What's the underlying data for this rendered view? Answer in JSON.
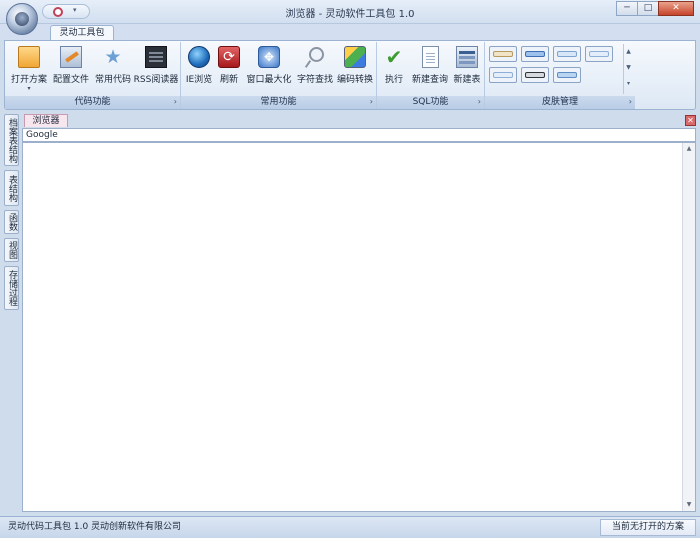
{
  "window": {
    "title": "浏览器 - 灵动软件工具包 1.0",
    "min_label": "─",
    "max_label": "□",
    "close_label": "✕"
  },
  "qat": {
    "more_glyph": "▾"
  },
  "ribbon": {
    "tab_label": "灵动工具包",
    "groups": [
      {
        "label": "代码功能",
        "buttons": [
          "打开方案",
          "配置文件",
          "常用代码",
          "RSS阅读器"
        ]
      },
      {
        "label": "常用功能",
        "buttons": [
          "IE浏览",
          "刷新",
          "窗口最大化",
          "字符查找",
          "编码转换"
        ]
      },
      {
        "label": "SQL功能",
        "buttons": [
          "执行",
          "新建查询",
          "新建表"
        ]
      },
      {
        "label": "皮肤管理",
        "buttons": []
      }
    ],
    "launcher_glyph": "›",
    "dropdown_glyph": "▾",
    "refresh_glyph": "⟳",
    "max_glyph": "✥",
    "star_glyph": "★",
    "check_glyph": "✔",
    "skin_scroll_up": "▲",
    "skin_scroll_mid": "▼",
    "skin_scroll_more": "▾"
  },
  "sidetabs": [
    "档案表结构",
    "表结构",
    "函数",
    "视图",
    "存储过程"
  ],
  "document": {
    "tab_label": "浏览器",
    "close_glyph": "✕",
    "address": "Google",
    "scroll_up": "▲",
    "scroll_down": "▼"
  },
  "status": {
    "left": "灵动代码工具包 1.0  灵动创新软件有限公司",
    "right": "当前无打开的方案"
  },
  "colors": {
    "accent": "#1f6dbb",
    "close": "#c7442b",
    "ribbon_border": "#9db3d2"
  }
}
